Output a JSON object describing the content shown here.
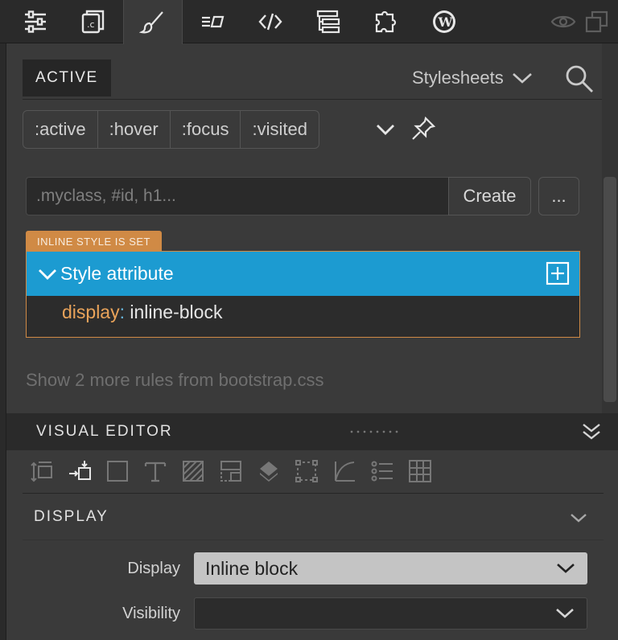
{
  "toolbar": {
    "items": [
      {
        "icon": "sliders-icon"
      },
      {
        "icon": "code-file-icon"
      },
      {
        "icon": "brush-icon",
        "active": true
      },
      {
        "icon": "text-box-icon"
      },
      {
        "icon": "code-tags-icon"
      },
      {
        "icon": "tree-icon"
      },
      {
        "icon": "puzzle-icon"
      },
      {
        "icon": "wordpress-icon"
      }
    ],
    "right": [
      {
        "icon": "eye-icon"
      },
      {
        "icon": "windows-icon"
      }
    ]
  },
  "panel": {
    "state_tag": "ACTIVE",
    "stylesheets_label": "Stylesheets",
    "pseudo_classes": [
      ":active",
      ":hover",
      ":focus",
      ":visited"
    ],
    "selector_input": {
      "placeholder": ".myclass, #id, h1..."
    },
    "create_label": "Create",
    "more_label": "...",
    "inline_badge": "INLINE STYLE IS SET",
    "rule": {
      "title": "Style attribute",
      "property": "display",
      "colon": ":",
      "value": "inline-block"
    },
    "more_rules": "Show 2 more rules from bootstrap.css"
  },
  "visual_editor": {
    "title": "VISUAL EDITOR",
    "section_title": "DISPLAY",
    "fields": [
      {
        "label": "Display",
        "value": "Inline block"
      },
      {
        "label": "Visibility",
        "value": ""
      }
    ]
  },
  "colors": {
    "accent": "#1c9bd1",
    "inline_badge": "#d08a45",
    "property": "#e9a35a"
  }
}
